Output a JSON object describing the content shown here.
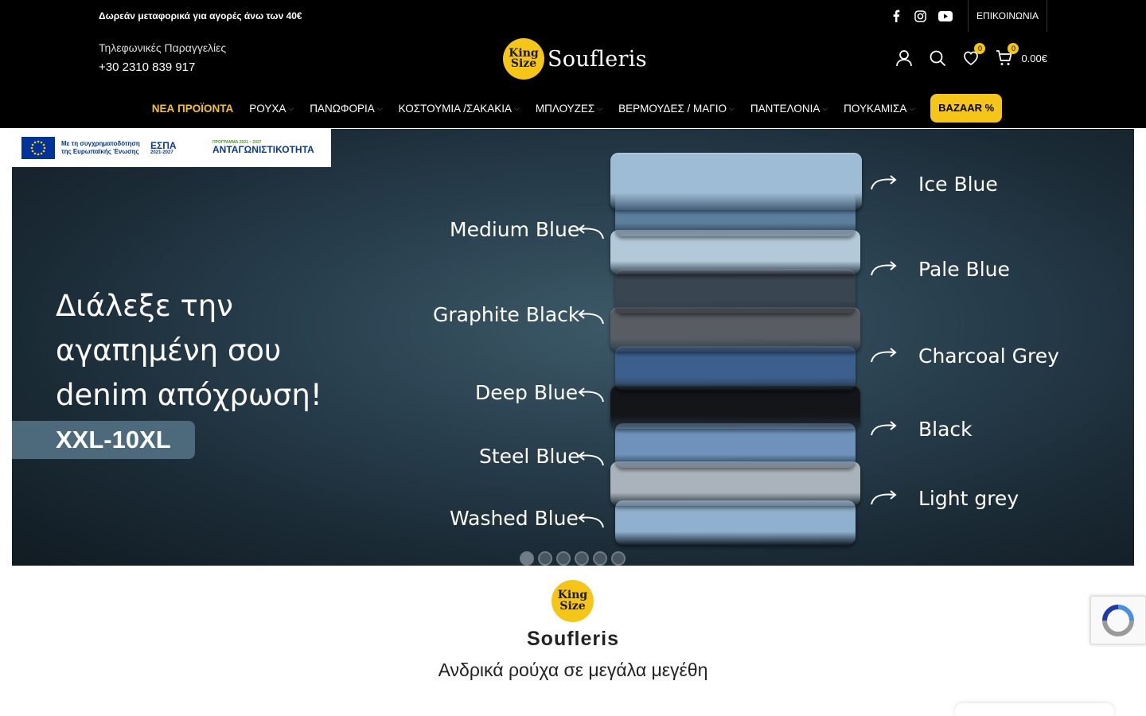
{
  "topbar": {
    "free_shipping": "Δωρεάν μεταφορικά για αγορές άνω των 40€",
    "contact": "ΕΠΙΚΟΙΝΩΝΙΑ",
    "social_icons": [
      "facebook-icon",
      "instagram-icon",
      "youtube-icon"
    ]
  },
  "header": {
    "phone_label": "Τηλεφωνικές Παραγγελίες",
    "phone_number": "+30 2310 839 917",
    "logo_badge_top": "King",
    "logo_badge_bottom": "Size",
    "logo_text": "Soufleris",
    "wishlist_count": "0",
    "cart_count": "0",
    "cart_total": "0.00€"
  },
  "nav": {
    "items": [
      {
        "label": "ΝΕΑ ΠΡΟΪΟΝΤΑ",
        "active": true
      },
      {
        "label": "ΡΟΥΧΑ"
      },
      {
        "label": "ΠΑΝΩΦΟΡΙΑ"
      },
      {
        "label": "ΚΟΣΤΟΥΜΙΑ /ΣΑΚΑΚΙΑ"
      },
      {
        "label": "ΜΠΛΟΥΖΕΣ"
      },
      {
        "label": "ΒΕΡΜΟΥΔΕΣ / ΜΑΓΙΟ"
      },
      {
        "label": "ΠΑΝΤΕΛΟΝΙΑ"
      },
      {
        "label": "ΠΟΥΚΑΜΙΣΑ"
      }
    ],
    "bazaar": "BAZAAR %"
  },
  "espa": {
    "eu_text": "Με τη συγχρηματοδότηση της Ευρωπαϊκής Ένωσης",
    "espa_title": "ΕΣΠΑ",
    "espa_years": "2021-2027",
    "program_small": "ΠΡΟΓΡΑΜΜΑ",
    "program_years": "2021 – 2027",
    "program_name": "ΑΝΤΑΓΩΝΙΣΤΙΚΟΤΗΤΑ"
  },
  "hero": {
    "headline_line1": "Διάλεξε την",
    "headline_line2": "αγαπημένη σου",
    "headline_line3": "denim απόχρωση!",
    "size_range": "XXL-10XL",
    "left_labels": [
      "Medium Blue",
      "Graphite Black",
      "Deep Blue",
      "Steel Blue",
      "Washed Blue"
    ],
    "right_labels": [
      "Ice Blue",
      "Pale Blue",
      "Charcoal Grey",
      "Black",
      "Light grey"
    ],
    "jean_colors": [
      "#9fbcd6",
      "#5d7f9e",
      "#b3c8d8",
      "#3a4552",
      "#595d63",
      "#3d5f8e",
      "#141518",
      "#6e92bb",
      "#aab3bb",
      "#8fb0cf"
    ],
    "slides": 6,
    "active_slide": 1
  },
  "brand": {
    "badge_top": "King",
    "badge_bottom": "Size",
    "name": "Soufleris",
    "tagline": "Ανδρικά ρούχα σε μεγάλα μεγέθη"
  }
}
